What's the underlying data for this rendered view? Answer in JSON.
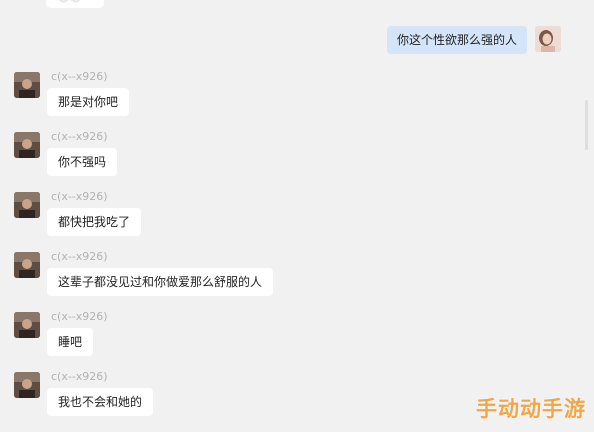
{
  "top_partial": {
    "text": "嗯嗯"
  },
  "self_message": {
    "text": "你这个性欲那么强的人"
  },
  "sender_name": "c(x--x926)",
  "messages": [
    {
      "sender": "c(x--x926)",
      "text": "那是对你吧"
    },
    {
      "sender": "c(x--x926)",
      "text": "你不强吗"
    },
    {
      "sender": "c(x--x926)",
      "text": "都快把我吃了"
    },
    {
      "sender": "c(x--x926)",
      "text": "这辈子都没见过和你做爱那么舒服的人"
    },
    {
      "sender": "c(x--x926)",
      "text": "睡吧"
    },
    {
      "sender": "c(x--x926)",
      "text": "我也不会和她的"
    }
  ],
  "watermark": {
    "text": "手动动手游"
  },
  "colors": {
    "background": "#f1f1f1",
    "self_bubble": "#d4e5fa",
    "other_bubble": "#ffffff",
    "sender_name": "#b2b2b2",
    "watermark": "#f0a64a"
  }
}
